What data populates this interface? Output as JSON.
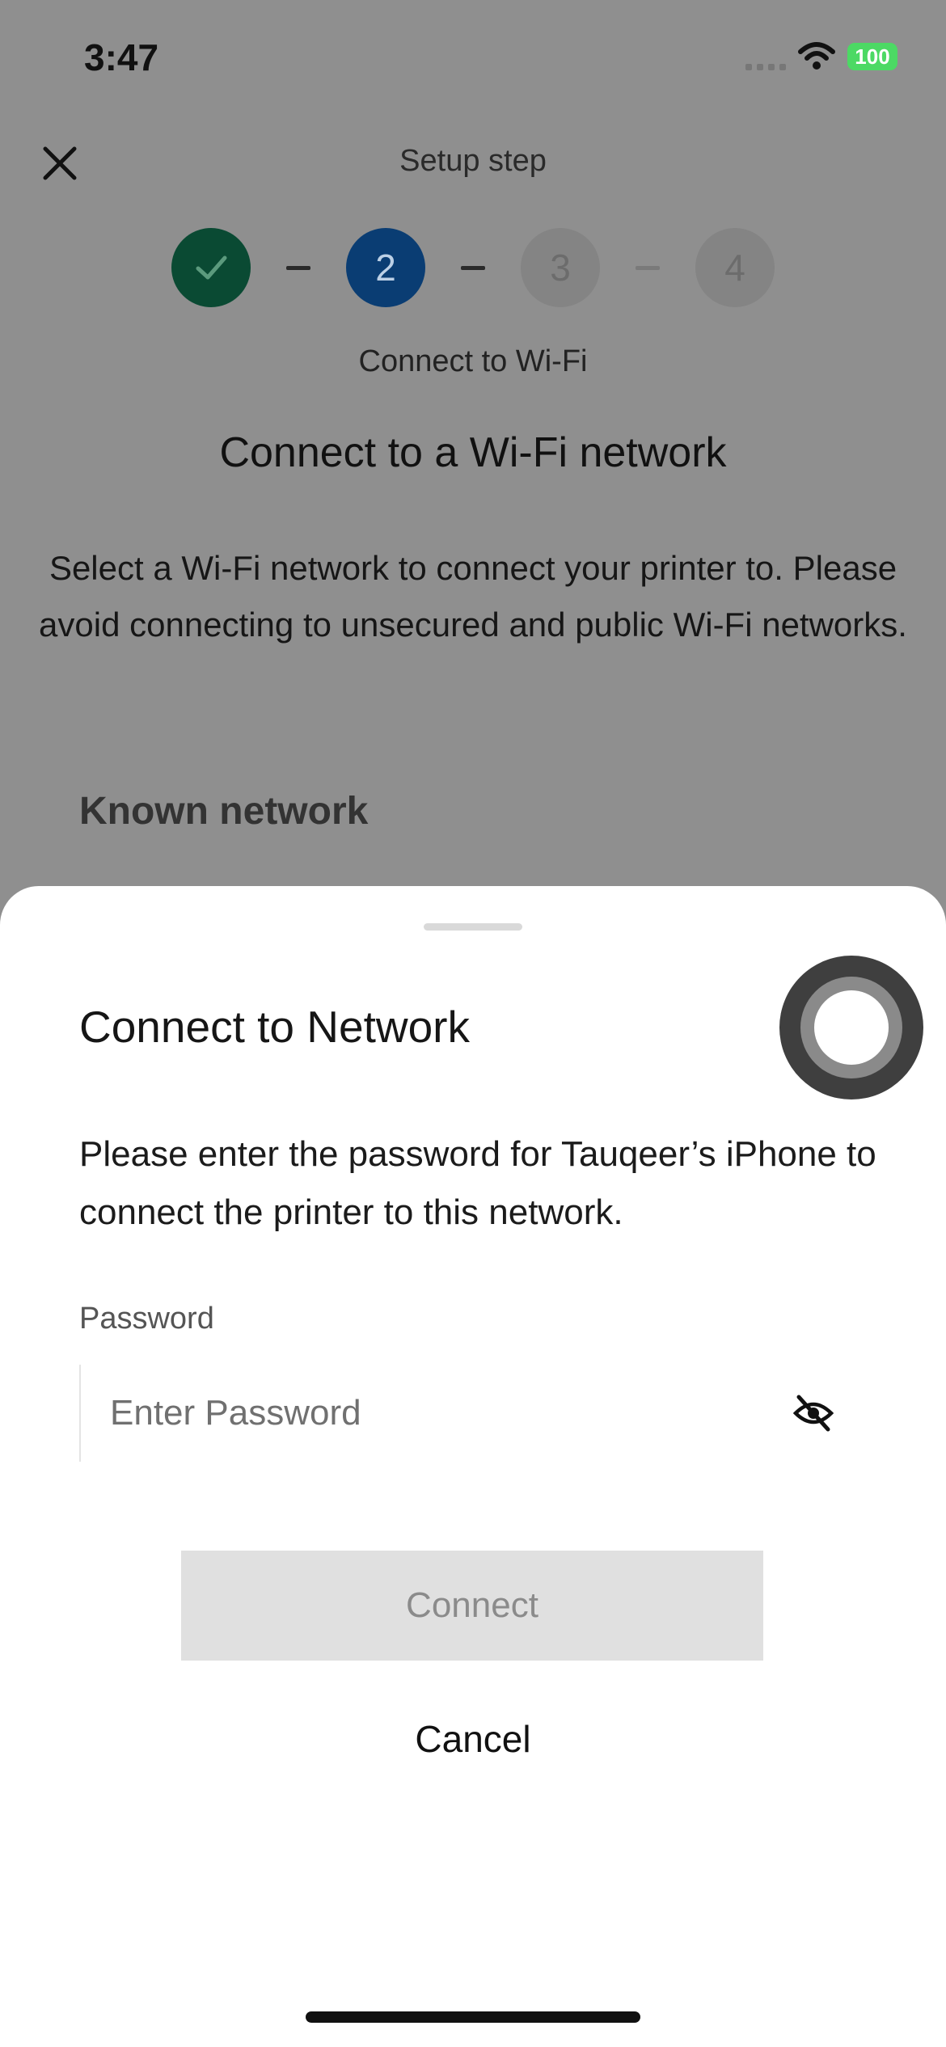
{
  "status_bar": {
    "time": "3:47",
    "battery": "100"
  },
  "header": {
    "title": "Setup step",
    "close_icon": "close-icon"
  },
  "stepper": {
    "steps": [
      {
        "label": "",
        "state": "done"
      },
      {
        "label": "2",
        "state": "active"
      },
      {
        "label": "3",
        "state": "todo"
      },
      {
        "label": "4",
        "state": "todo"
      }
    ],
    "current_label": "Connect to Wi-Fi"
  },
  "background": {
    "title": "Connect to a Wi-Fi network",
    "description": "Select a Wi-Fi network to connect your printer to. Please avoid connecting to unsecured and public Wi-Fi networks.",
    "section_heading": "Known network"
  },
  "sheet": {
    "title": "Connect to Network",
    "description": "Please enter the password for Tauqeer’s iPhone to connect the printer to this network.",
    "password_label": "Password",
    "password_placeholder": "Enter Password",
    "password_value": "",
    "connect_label": "Connect",
    "cancel_label": "Cancel"
  },
  "colors": {
    "step_done": "#0a4a33",
    "step_active": "#0a3d73",
    "battery": "#4cd964",
    "button_disabled": "#e0e0e0"
  }
}
